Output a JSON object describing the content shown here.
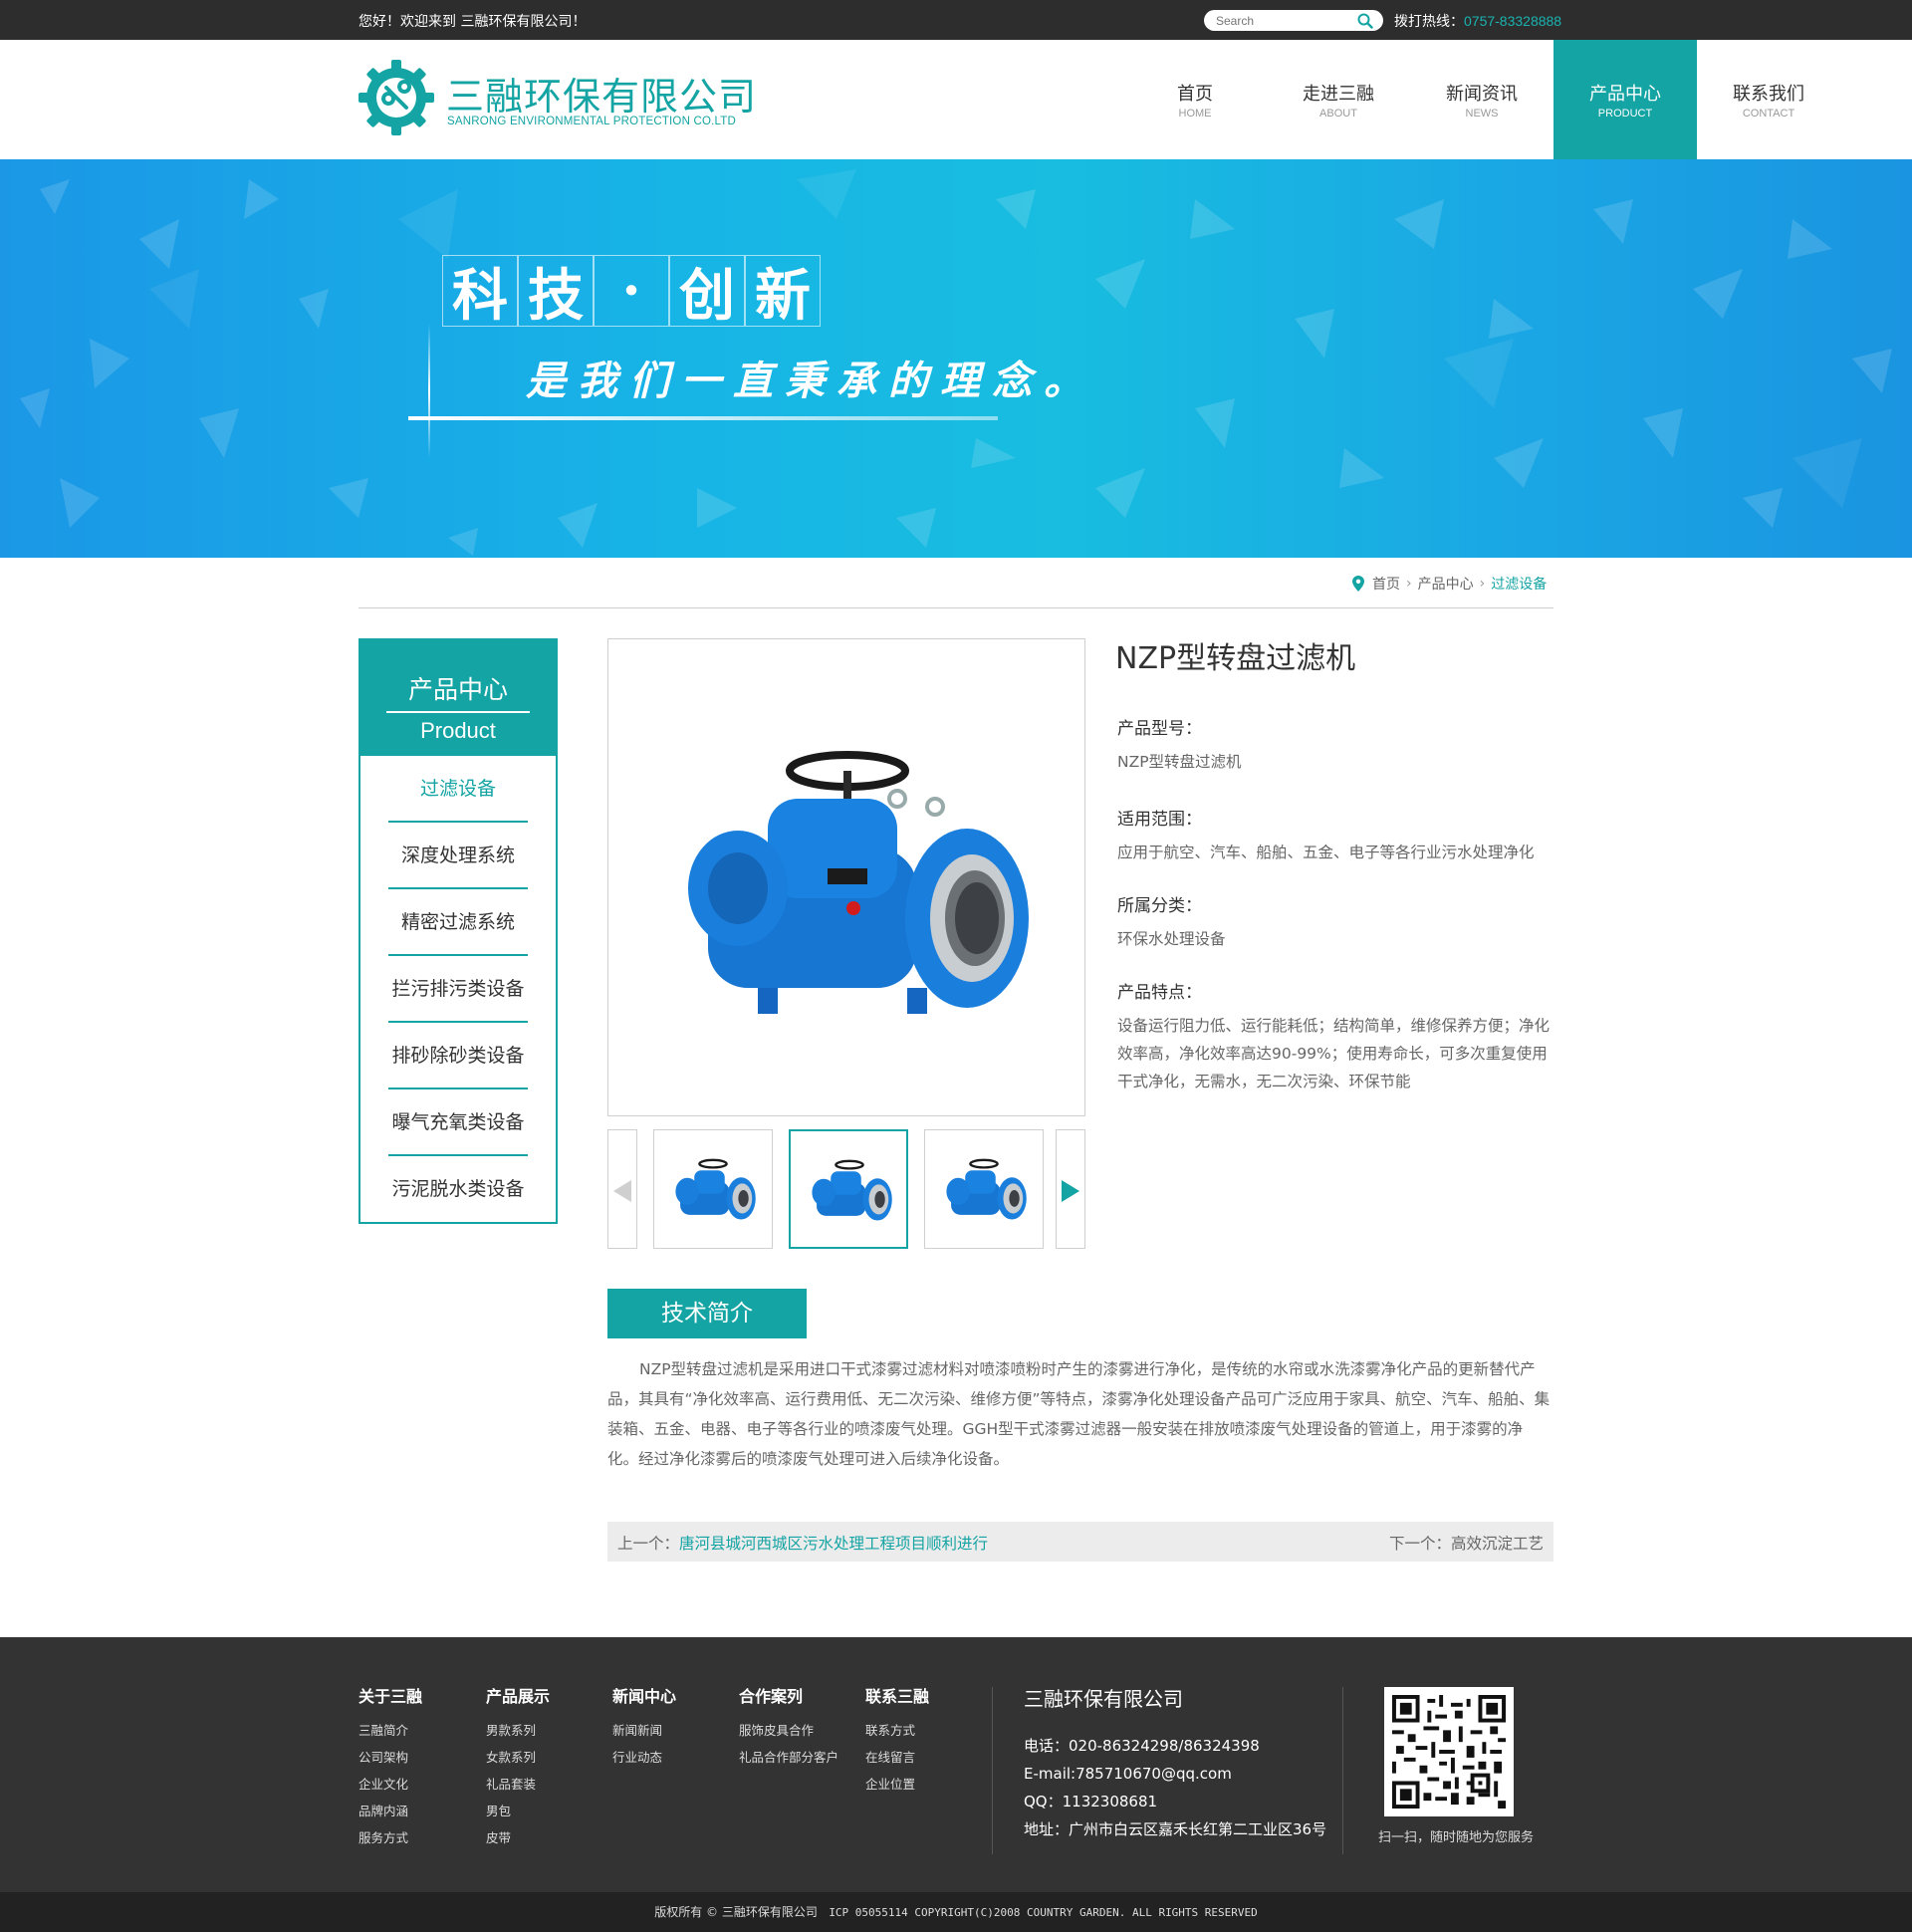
{
  "topbar": {
    "welcome": "您好！欢迎来到 三融环保有限公司！",
    "search_placeholder": "Search",
    "hotline_label": "拨打热线：",
    "hotline_number": "0757-83328888"
  },
  "logo": {
    "cn": "三融环保有限公司",
    "en": "SANRONG ENVIRONMENTAL PROTECTION CO.LTD"
  },
  "nav": [
    {
      "cn": "首页",
      "en": "HOME",
      "active": false
    },
    {
      "cn": "走进三融",
      "en": "ABOUT",
      "active": false
    },
    {
      "cn": "新闻资讯",
      "en": "NEWS",
      "active": false
    },
    {
      "cn": "产品中心",
      "en": "PRODUCT",
      "active": true
    },
    {
      "cn": "联系我们",
      "en": "CONTACT",
      "active": false
    }
  ],
  "banner": {
    "title_chars": [
      "科",
      "技",
      "·",
      "创",
      "新"
    ],
    "subtitle": "是我们一直秉承的理念。"
  },
  "breadcrumb": {
    "home": "首页",
    "section": "产品中心",
    "current": "过滤设备"
  },
  "sidebar": {
    "title_cn": "产品中心",
    "title_en": "Product",
    "items": [
      {
        "label": "过滤设备",
        "active": true
      },
      {
        "label": "深度处理系统",
        "active": false
      },
      {
        "label": "精密过滤系统",
        "active": false
      },
      {
        "label": "拦污排污类设备",
        "active": false
      },
      {
        "label": "排砂除砂类设备",
        "active": false
      },
      {
        "label": "曝气充氧类设备",
        "active": false
      },
      {
        "label": "污泥脱水类设备",
        "active": false
      }
    ]
  },
  "product": {
    "name": "NZP型转盘过滤机",
    "model_label": "产品型号：",
    "model_value": "NZP型转盘过滤机",
    "scope_label": "适用范围：",
    "scope_value": "应用于航空、汽车、船舶、五金、电子等各行业污水处理净化",
    "category_label": "所属分类：",
    "category_value": "环保水处理设备",
    "features_label": "产品特点：",
    "features_value": "设备运行阻力低、运行能耗低；结构简单，维修保养方便；净化效率高，净化效率高达90-99%；使用寿命长，可多次重复使用干式净化，无需水，无二次污染、环保节能"
  },
  "tech": {
    "tab_label": "技术简介",
    "body": "NZP型转盘过滤机是采用进口干式漆雾过滤材料对喷漆喷粉时产生的漆雾进行净化，是传统的水帘或水洗漆雾净化产品的更新替代产品，其具有“净化效率高、运行费用低、无二次污染、维修方便”等特点，漆雾净化处理设备产品可广泛应用于家具、航空、汽车、船舶、集装箱、五金、电器、电子等各行业的喷漆废气处理。GGH型干式漆雾过滤器一般安装在排放喷漆废气处理设备的管道上，用于漆雾的净化。经过净化漆雾后的喷漆废气处理可进入后续净化设备。"
  },
  "prevnext": {
    "prev_label": "上一个：",
    "prev_link": "唐河县城河西城区污水处理工程项目顺利进行",
    "next_label": "下一个：",
    "next_link": "高效沉淀工艺"
  },
  "footer": {
    "cols": [
      {
        "title": "关于三融",
        "links": [
          "三融简介",
          "公司架构",
          "企业文化",
          "品牌内涵",
          "服务方式"
        ]
      },
      {
        "title": "产品展示",
        "links": [
          "男款系列",
          "女款系列",
          "礼品套装",
          "男包",
          "皮带"
        ]
      },
      {
        "title": "新闻中心",
        "links": [
          "新闻新闻",
          "行业动态"
        ]
      },
      {
        "title": "合作案列",
        "links": [
          "服饰皮具合作",
          "礼品合作部分客户"
        ]
      },
      {
        "title": "联系三融",
        "links": [
          "联系方式",
          "在线留言",
          "企业位置"
        ]
      }
    ],
    "company": "三融环保有限公司",
    "phone": "电话：020-86324298/86324398",
    "email": "E-mail:785710670@qq.com",
    "qq": "QQ：1132308681",
    "address": "地址：广州市白云区嘉禾长红第二工业区36号",
    "qr_caption": "扫一扫，随时随地为您服务",
    "copyright_cn": "版权所有 ©  三融环保有限公司",
    "copyright_en": "ICP 05055114 COPYRIGHT(C)2008 COUNTRY GARDEN. ALL RIGHTS RESERVED"
  }
}
